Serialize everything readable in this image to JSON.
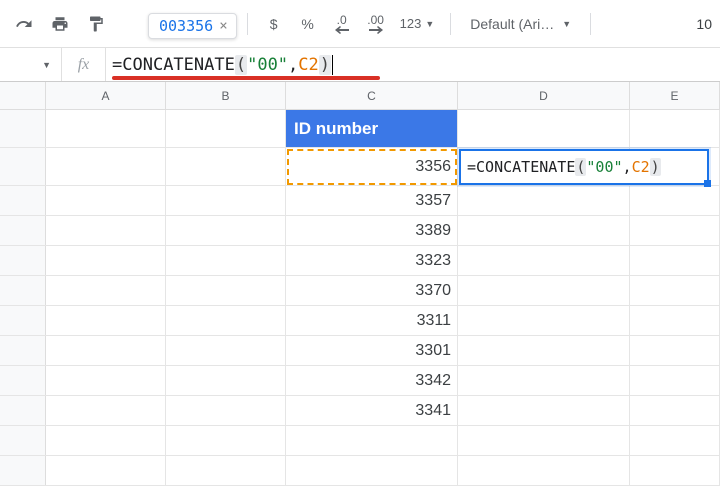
{
  "toolbar": {
    "tooltip_value": "003356",
    "currency": "$",
    "percent": "%",
    "dec_dec": ".0",
    "inc_dec": ".00",
    "format_num": "123",
    "font_name": "Default (Ari…",
    "font_size": "10"
  },
  "formula": {
    "eq": "=",
    "fn": "CONCATENATE",
    "open": "(",
    "arg1": "\"00\"",
    "comma": ", ",
    "arg2": "C2",
    "close": ")"
  },
  "columns": {
    "a": "A",
    "b": "B",
    "c": "C",
    "d": "D",
    "e": "E"
  },
  "header_c": "ID number",
  "data_c": [
    "3356",
    "3357",
    "3389",
    "3323",
    "3370",
    "3311",
    "3301",
    "3342",
    "3341"
  ],
  "active_cell": {
    "eq": "=",
    "fn": "CONCATENATE",
    "open": "(",
    "arg1": "\"00\"",
    "comma": ", ",
    "arg2": "C2",
    "close": ")"
  }
}
